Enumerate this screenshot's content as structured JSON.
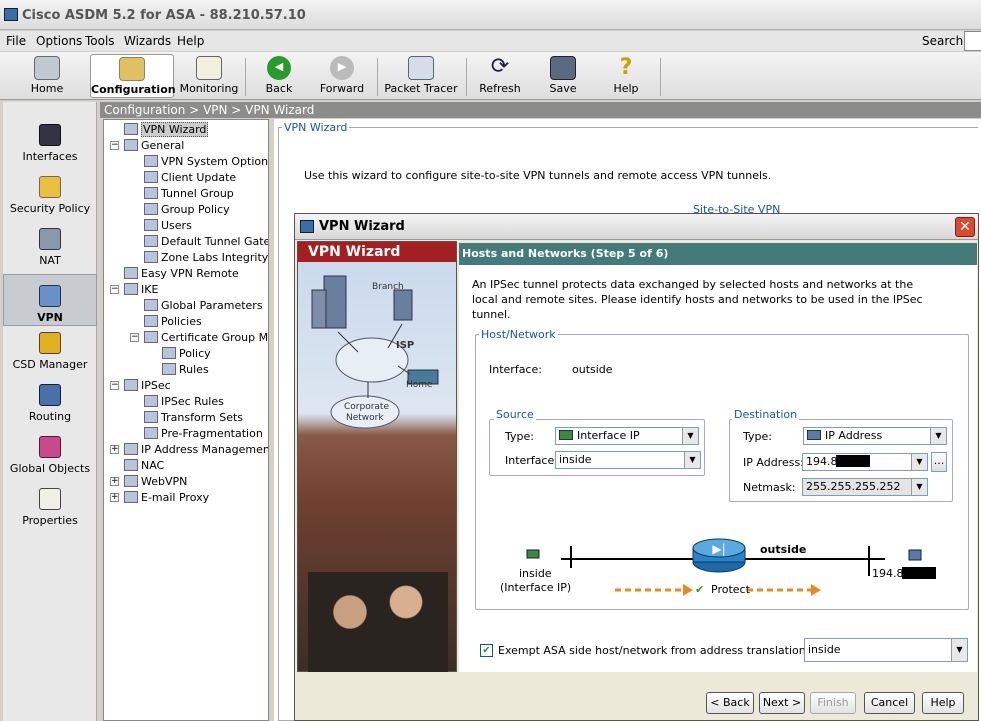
{
  "window": {
    "title": "Cisco ASDM 5.2 for ASA - 88.210.57.10"
  },
  "menu": {
    "file": "File",
    "options": "Options",
    "tools": "Tools",
    "wizards": "Wizards",
    "help": "Help",
    "search_label": "Search:",
    "search_value": ""
  },
  "toolbar": {
    "home": "Home",
    "configuration": "Configuration",
    "monitoring": "Monitoring",
    "back": "Back",
    "forward": "Forward",
    "packet_tracer": "Packet Tracer",
    "refresh": "Refresh",
    "save": "Save",
    "help": "Help"
  },
  "leftnav": {
    "interfaces": "Interfaces",
    "security_policy": "Security Policy",
    "nat": "NAT",
    "vpn": "VPN",
    "csd_manager": "CSD Manager",
    "routing": "Routing",
    "global_objects": "Global Objects",
    "properties": "Properties"
  },
  "breadcrumb": "Configuration > VPN > VPN Wizard",
  "tree": {
    "vpn_wizard": "VPN Wizard",
    "general": "General",
    "vpn_system_options": "VPN System Options",
    "client_update": "Client Update",
    "tunnel_group": "Tunnel Group",
    "group_policy": "Group Policy",
    "users": "Users",
    "default_tunnel_gateway": "Default Tunnel Gatew",
    "zone_labs": "Zone Labs Integrity Se",
    "easy_vpn_remote": "Easy VPN Remote",
    "ike": "IKE",
    "global_parameters": "Global Parameters",
    "policies": "Policies",
    "certificate_group": "Certificate Group Matc",
    "policy": "Policy",
    "rules": "Rules",
    "ipsec": "IPSec",
    "ipsec_rules": "IPSec Rules",
    "transform_sets": "Transform Sets",
    "pre_fragmentation": "Pre-Fragmentation",
    "ip_address_management": "IP Address Management",
    "nac": "NAC",
    "webvpn": "WebVPN",
    "email_proxy": "E-mail Proxy"
  },
  "main": {
    "legend": "VPN Wizard",
    "intro": "Use this wizard to configure site-to-site VPN tunnels  and remote access VPN tunnels.",
    "site_to_site": "Site-to-Site VPN"
  },
  "dialog": {
    "title": "VPN Wizard",
    "banner_title": "VPN Wizard",
    "banner_labels": {
      "branch": "Branch",
      "isp": "ISP",
      "home": "Home",
      "corporate": "Corporate",
      "network": "Network"
    },
    "step_title": "Hosts and Networks  (Step 5 of 6)",
    "description": "An IPSec tunnel protects data exchanged by selected hosts and networks at the local and remote sites. Please identify hosts and networks to be used in the IPSec tunnel.",
    "host_network_legend": "Host/Network",
    "interface_label": "Interface:",
    "interface_value": "outside",
    "source": {
      "legend": "Source",
      "type_label": "Type:",
      "type_value": "Interface IP",
      "interface_label": "Interface:",
      "interface_value": "inside"
    },
    "destination": {
      "legend": "Destination",
      "type_label": "Type:",
      "type_value": "IP Address",
      "ip_label": "IP Address:",
      "ip_value": "194.8",
      "netmask_label": "Netmask:",
      "netmask_value": "255.255.255.252",
      "browse": "..."
    },
    "diagram": {
      "inside": "inside",
      "interface_ip": "(Interface IP)",
      "outside": "outside",
      "protect": "Protect",
      "remote": "194.8"
    },
    "exempt_label": "Exempt ASA side host/network from address translation:",
    "exempt_checked": true,
    "exempt_value": "inside",
    "buttons": {
      "back": "< Back",
      "next": "Next >",
      "finish": "Finish",
      "cancel": "Cancel",
      "help": "Help"
    }
  },
  "colors": {
    "step_bar": "#437a7a",
    "banner_header": "#a42020",
    "link": "#1a55a8",
    "breadcrumb": "#8c8c8c"
  }
}
